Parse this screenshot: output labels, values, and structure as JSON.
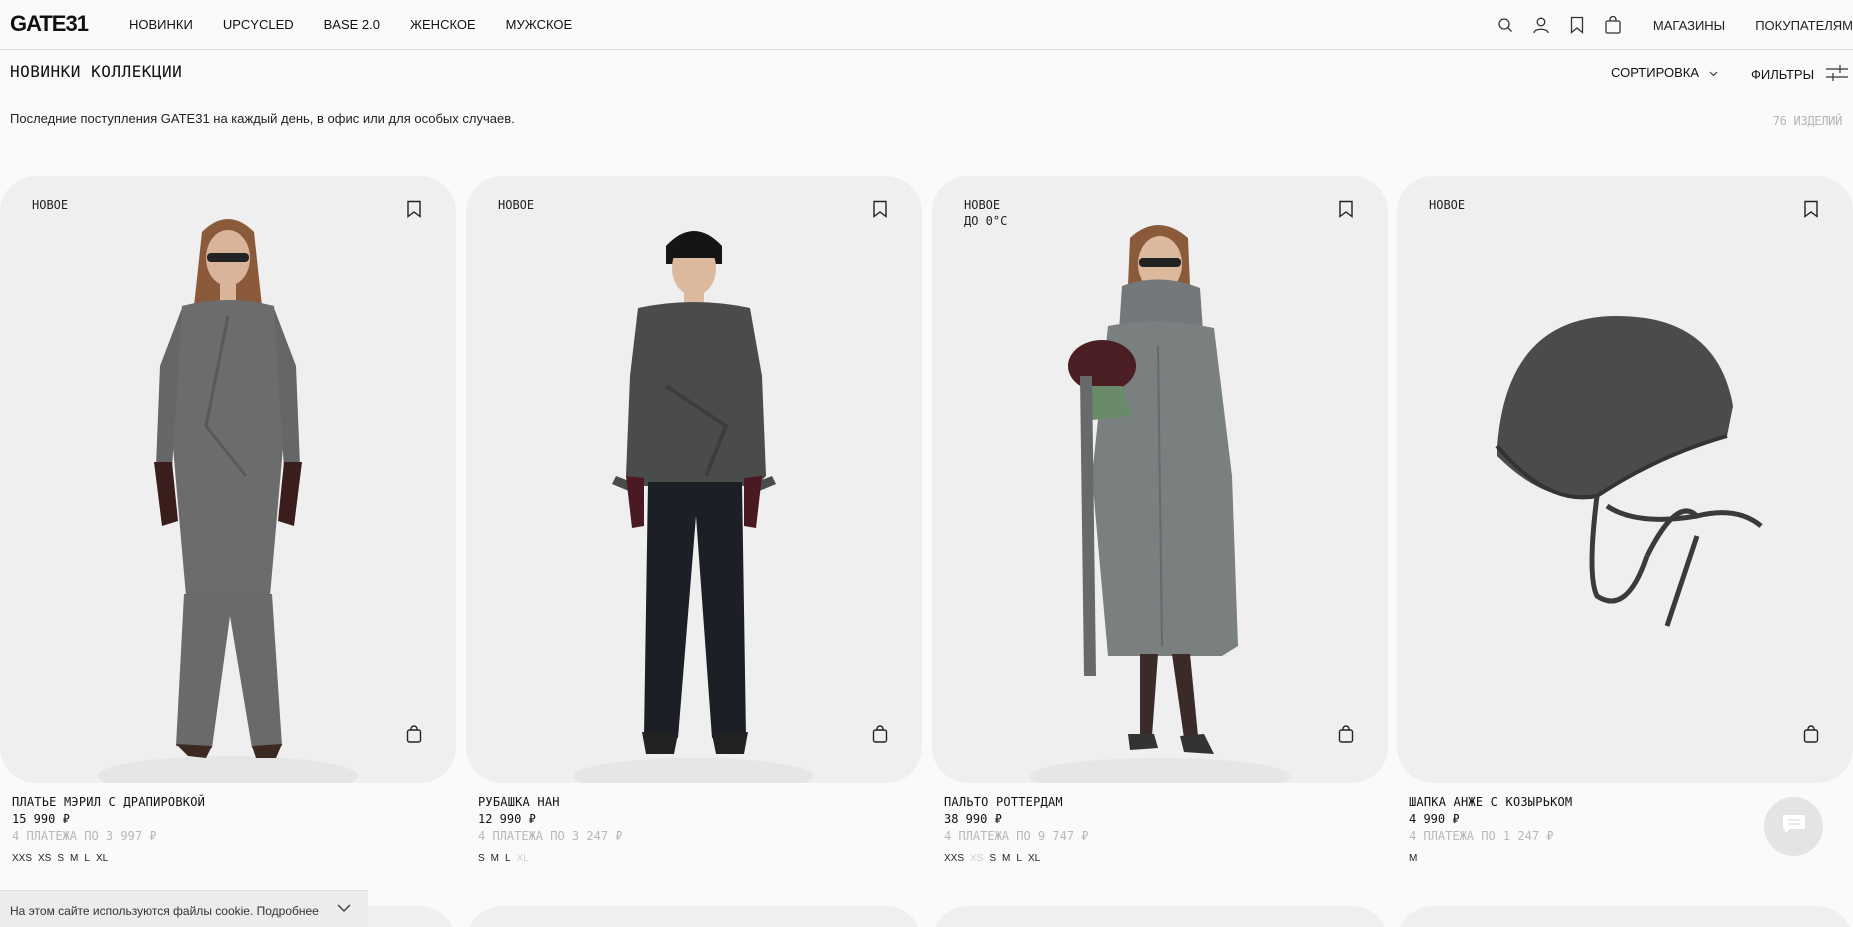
{
  "header": {
    "logo": "GATE31",
    "nav": [
      "НОВИНКИ",
      "UPCYCLED",
      "BASE 2.0",
      "ЖЕНСКОЕ",
      "МУЖСКОЕ"
    ],
    "icons": [
      "search-icon",
      "user-icon",
      "bookmark-icon",
      "bag-icon"
    ],
    "links": [
      "МАГАЗИНЫ",
      "ПОКУПАТЕЛЯМ"
    ]
  },
  "collection": {
    "title": "НОВИНКИ КОЛЛЕКЦИИ",
    "sort_label": "СОРТИРОВКА",
    "filters_label": "ФИЛЬТРЫ",
    "description": "Последние поступления GATE31 на каждый день, в офис или для особых случаев.",
    "count": "76 ИЗДЕЛИЙ"
  },
  "products": [
    {
      "badges": [
        "НОВОЕ"
      ],
      "name": "ПЛАТЬЕ МЭРИЛ С ДРАПИРОВКОЙ",
      "price": "15 990 ₽",
      "installments": "4 ПЛАТЕЖА ПО 3 997 ₽",
      "sizes": [
        {
          "label": "XXS",
          "available": true
        },
        {
          "label": "XS",
          "available": true
        },
        {
          "label": "S",
          "available": true
        },
        {
          "label": "M",
          "available": true
        },
        {
          "label": "L",
          "available": true
        },
        {
          "label": "XL",
          "available": true
        }
      ]
    },
    {
      "badges": [
        "НОВОЕ"
      ],
      "name": "РУБАШКА НАН",
      "price": "12 990 ₽",
      "installments": "4 ПЛАТЕЖА ПО 3 247 ₽",
      "sizes": [
        {
          "label": "S",
          "available": true
        },
        {
          "label": "M",
          "available": true
        },
        {
          "label": "L",
          "available": true
        },
        {
          "label": "XL",
          "available": false
        }
      ]
    },
    {
      "badges": [
        "НОВОЕ",
        "ДО 0°С"
      ],
      "name": "ПАЛЬТО РОТТЕРДАМ",
      "price": "38 990 ₽",
      "installments": "4 ПЛАТЕЖА ПО 9 747 ₽",
      "sizes": [
        {
          "label": "XXS",
          "available": true
        },
        {
          "label": "XS",
          "available": false
        },
        {
          "label": "S",
          "available": true
        },
        {
          "label": "M",
          "available": true
        },
        {
          "label": "L",
          "available": true
        },
        {
          "label": "XL",
          "available": true
        }
      ]
    },
    {
      "badges": [
        "НОВОЕ"
      ],
      "name": "ШАПКА АНЖЕ С КОЗЫРЬКОМ",
      "price": "4 990 ₽",
      "installments": "4 ПЛАТЕЖА ПО 1 247 ₽",
      "sizes": [
        {
          "label": "M",
          "available": true
        }
      ]
    }
  ],
  "cookie": {
    "text": "На этом сайте используются файлы cookie. Подробнее"
  },
  "chat": {
    "icon": "chat-icon"
  }
}
